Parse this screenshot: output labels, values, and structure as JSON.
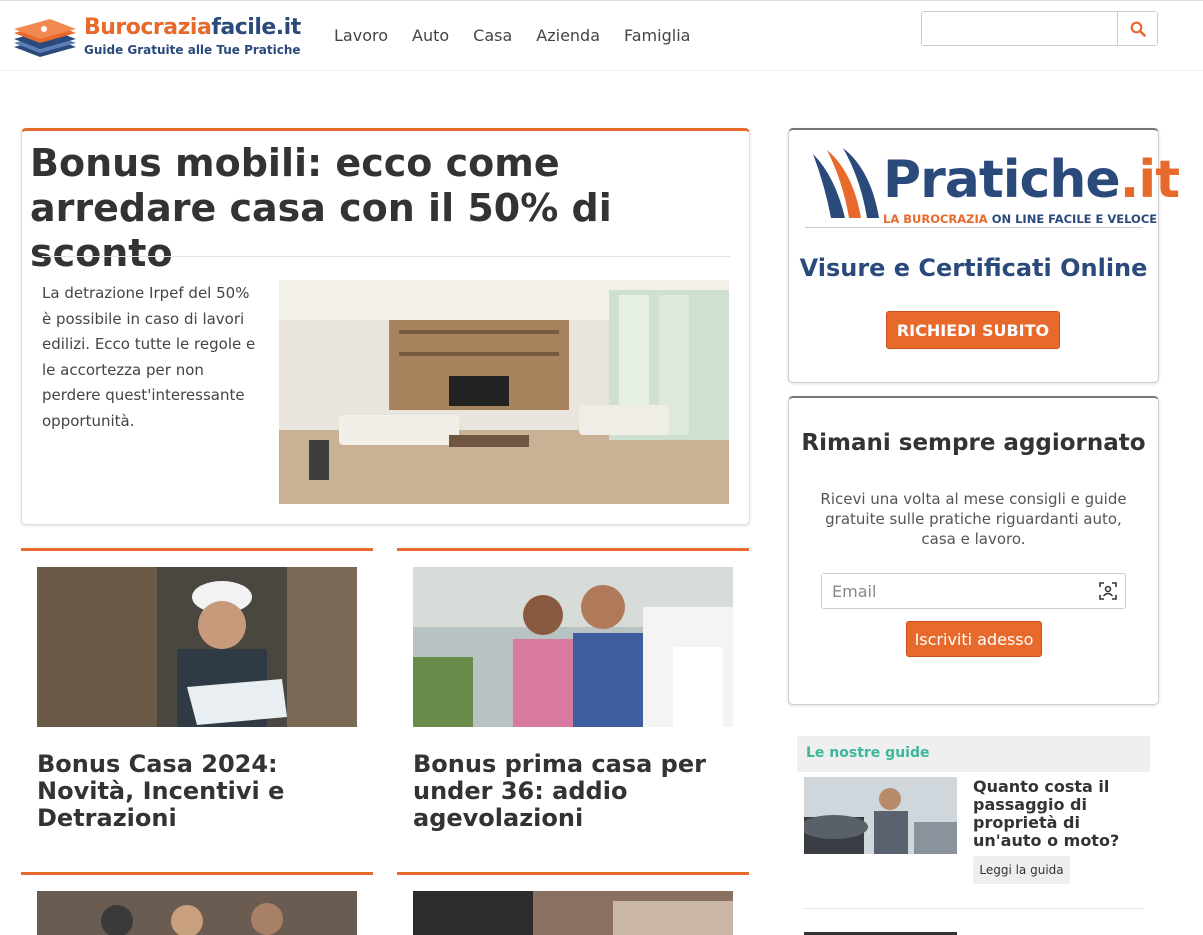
{
  "brand": {
    "name_part1": "Burocrazia",
    "name_part2": "facile.it",
    "tagline": "Guide Gratuite alle Tue Pratiche"
  },
  "nav": {
    "items": [
      "Lavoro",
      "Auto",
      "Casa",
      "Azienda",
      "Famiglia"
    ]
  },
  "search": {
    "placeholder": "",
    "icon": "search-icon"
  },
  "featured": {
    "title": "Bonus mobili: ecco come arredare casa con il 50% di sconto",
    "excerpt": "La detrazione Irpef del 50% è possibile in caso di lavori edilizi. Ecco tutte le regole e le accortezza per non perdere quest'interessante opportunità."
  },
  "cards": [
    {
      "title": "Bonus Casa 2024: Novità, Incentivi e Detrazioni"
    },
    {
      "title": "Bonus prima casa per under 36: addio agevolazioni"
    }
  ],
  "ad": {
    "logo_name": "Pratiche",
    "logo_ext": ".it",
    "logo_tag_part1": "LA BUROCRAZIA ",
    "logo_tag_part2": "ON LINE FACILE E VELOCE",
    "headline": "Visure e Certificati Online",
    "button": "RICHIEDI SUBITO"
  },
  "newsletter": {
    "title": "Rimani sempre aggiornato",
    "description": "Ricevi una volta al mese consigli e guide gratuite sulle pratiche riguardanti auto, casa e lavoro.",
    "email_placeholder": "Email",
    "button": "Iscriviti adesso"
  },
  "guides": {
    "heading": "Le nostre guide",
    "items": [
      {
        "title": "Quanto costa il passaggio di proprietà di un'auto o moto?",
        "button": "Leggi la guida"
      }
    ]
  },
  "colors": {
    "accent": "#e8692c",
    "brand_blue": "#2b4a7c",
    "guides_green": "#3bb89a"
  }
}
